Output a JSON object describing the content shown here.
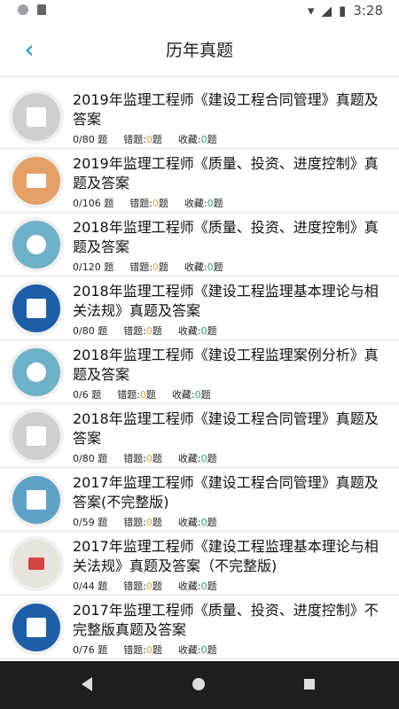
{
  "statusbar": {
    "time": "3:28"
  },
  "header": {
    "title": "历年真题"
  },
  "list": [
    {
      "icon": "doc-icon",
      "color": "#cfcfcf",
      "title": "2019年监理工程师《建设工程合同管理》真题及答案",
      "count": "0/80 题",
      "wrong_label": "错题:",
      "wrong": "0",
      "fav_label": "收藏:",
      "fav": "0"
    },
    {
      "icon": "folder-icon",
      "color": "#e3a067",
      "title": "2019年监理工程师《质量、投资、进度控制》真题及答案",
      "count": "0/106 题",
      "wrong_label": "错题:",
      "wrong": "0",
      "fav_label": "收藏:",
      "fav": "0"
    },
    {
      "icon": "eye-icon",
      "color": "#6fb1c7",
      "title": "2018年监理工程师《质量、投资、进度控制》真题及答案",
      "count": "0/120 题",
      "wrong_label": "错题:",
      "wrong": "0",
      "fav_label": "收藏:",
      "fav": "0"
    },
    {
      "icon": "edit-icon",
      "color": "#1d5ea6",
      "title": "2018年监理工程师《建设工程监理基本理论与相关法规》真题及答案",
      "count": "0/80 题",
      "wrong_label": "错题:",
      "wrong": "0",
      "fav_label": "收藏:",
      "fav": "0"
    },
    {
      "icon": "eye-icon",
      "color": "#6fb1c7",
      "title": "2018年监理工程师《建设工程监理案例分析》真题及答案",
      "count": "0/6 题",
      "wrong_label": "错题:",
      "wrong": "0",
      "fav_label": "收藏:",
      "fav": "0"
    },
    {
      "icon": "doc-icon",
      "color": "#cfcfcf",
      "title": " 2018年监理工程师《建设工程合同管理》真题及答案",
      "count": "0/80 题",
      "wrong_label": "错题:",
      "wrong": "0",
      "fav_label": "收藏:",
      "fav": "0"
    },
    {
      "icon": "clipboard-icon",
      "color": "#5fa2c8",
      "title": "2017年监理工程师《建设工程合同管理》真题及答案(不完整版)",
      "count": "0/59 题",
      "wrong_label": "错题:",
      "wrong": "0",
      "fav_label": "收藏:",
      "fav": "0"
    },
    {
      "icon": "flag-icon",
      "color": "#e6e4dc",
      "title": "2017年监理工程师《建设工程监理基本理论与相关法规》真题及答案（不完整版)",
      "count": "0/44 题",
      "wrong_label": "错题:",
      "wrong": "0",
      "fav_label": "收藏:",
      "fav": "0"
    },
    {
      "icon": "folder-open-icon",
      "color": "#1d5ea6",
      "title": "2017年监理工程师《质量、投资、进度控制》不完整版真题及答案",
      "count": "0/76 题",
      "wrong_label": "错题:",
      "wrong": "0",
      "fav_label": "收藏:",
      "fav": "0"
    }
  ]
}
